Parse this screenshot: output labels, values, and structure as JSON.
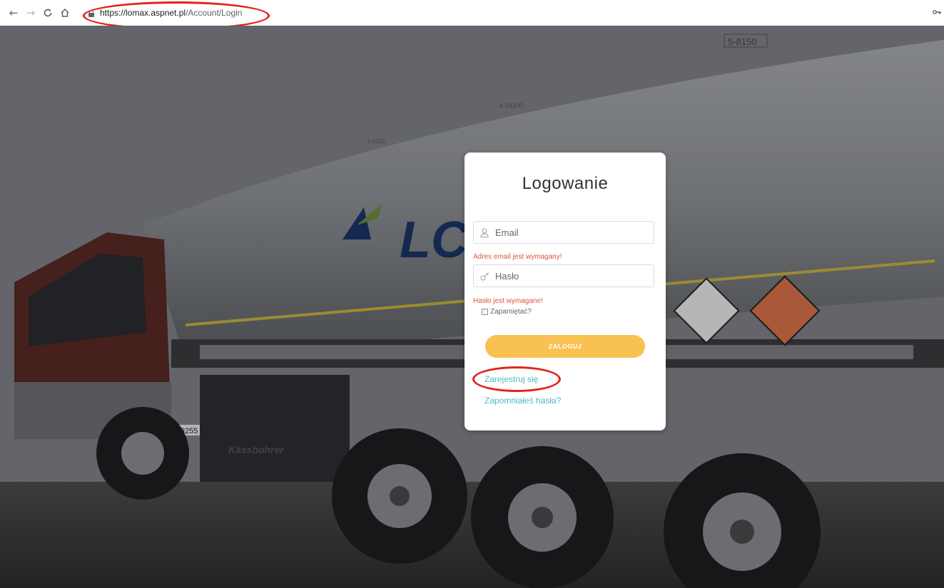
{
  "browser": {
    "url_host": "https://lomax.aspnet.pl",
    "url_path": "/Account/Login",
    "icons": [
      "back-arrow-icon",
      "forward-arrow-icon",
      "reload-icon",
      "home-icon",
      "lock-icon",
      "key-icon"
    ]
  },
  "login": {
    "title": "Logowanie",
    "email_placeholder": "Email",
    "email_error": "Adres email jest wymagany!",
    "password_placeholder": "Hasło",
    "password_error": "Hasło jest wymagane!",
    "remember_label": "Zapamiętać?",
    "submit_label": "ZALOGUJ",
    "register_link": "Zarejestruj się",
    "forgot_link": "Zapomniałeś hasła?"
  },
  "colors": {
    "accent_button": "#f8c152",
    "link": "#4fb9c3",
    "error": "#e0533d",
    "annotation": "#e3211b"
  }
}
